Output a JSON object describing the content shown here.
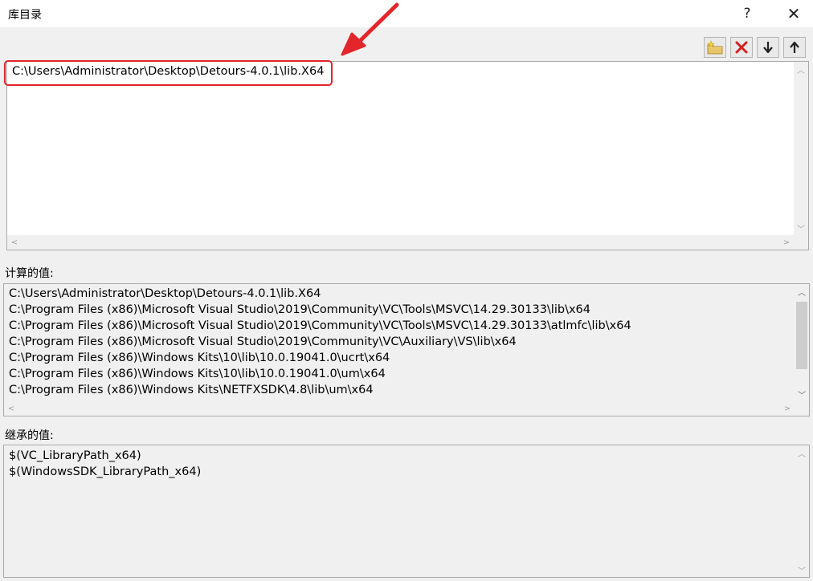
{
  "window": {
    "title": "库目录",
    "help_label": "?",
    "close_label": "✕"
  },
  "toolbar": {
    "buttons": [
      "new-folder-icon",
      "delete-icon",
      "move-down-icon",
      "move-up-icon"
    ]
  },
  "editor": {
    "lines": [
      "C:\\Users\\Administrator\\Desktop\\Detours-4.0.1\\lib.X64"
    ]
  },
  "computed": {
    "label": "计算的值:",
    "lines": [
      "C:\\Users\\Administrator\\Desktop\\Detours-4.0.1\\lib.X64",
      "C:\\Program Files (x86)\\Microsoft Visual Studio\\2019\\Community\\VC\\Tools\\MSVC\\14.29.30133\\lib\\x64",
      "C:\\Program Files (x86)\\Microsoft Visual Studio\\2019\\Community\\VC\\Tools\\MSVC\\14.29.30133\\atlmfc\\lib\\x64",
      "C:\\Program Files (x86)\\Microsoft Visual Studio\\2019\\Community\\VC\\Auxiliary\\VS\\lib\\x64",
      "C:\\Program Files (x86)\\Windows Kits\\10\\lib\\10.0.19041.0\\ucrt\\x64",
      "C:\\Program Files (x86)\\Windows Kits\\10\\lib\\10.0.19041.0\\um\\x64",
      "C:\\Program Files (x86)\\Windows Kits\\NETFXSDK\\4.8\\lib\\um\\x64"
    ]
  },
  "inherited": {
    "label": "继承的值:",
    "lines": [
      "$(VC_LibraryPath_x64)",
      "$(WindowsSDK_LibraryPath_x64)"
    ]
  },
  "colors": {
    "annotation": "#e3262b",
    "delete_icon": "#d61f1f"
  }
}
